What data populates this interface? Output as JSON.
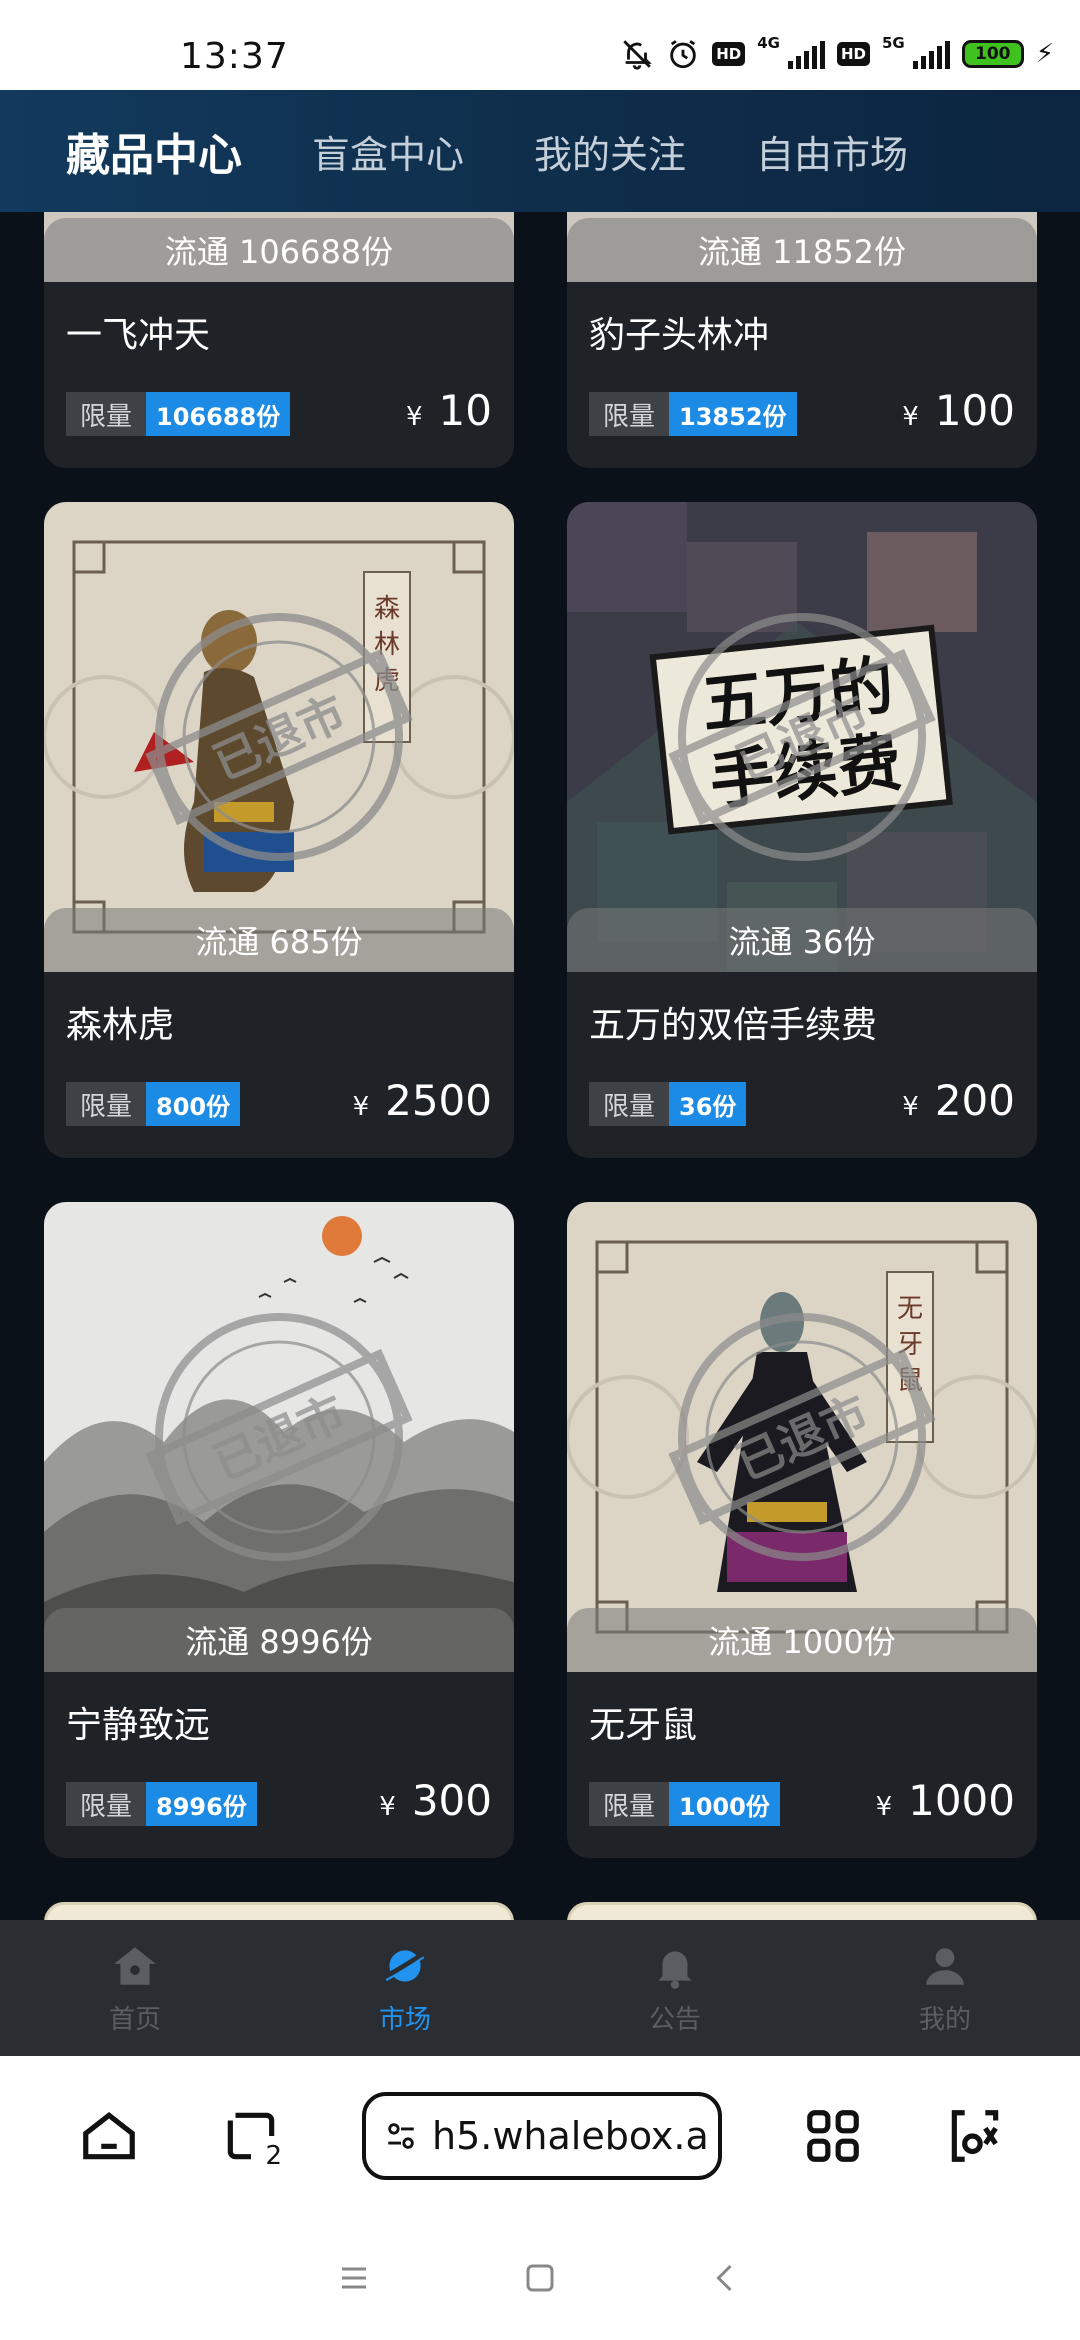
{
  "status_bar": {
    "time": "13:37",
    "net1": "4G",
    "net2": "5G",
    "hd": "HD",
    "battery": "100",
    "icons": [
      "mute-bell-icon",
      "alarm-icon",
      "hd-icon",
      "signal-icon",
      "battery-icon",
      "charging-icon"
    ]
  },
  "top_tabs": [
    {
      "label": "藏品中心",
      "active": true
    },
    {
      "label": "盲盒中心",
      "active": false
    },
    {
      "label": "我的关注",
      "active": false
    },
    {
      "label": "自由市场",
      "active": false
    }
  ],
  "cards": [
    {
      "circulation": "流通 106688份",
      "title": "一飞冲天",
      "limit_label": "限量",
      "limit_value": "106688份",
      "price_symbol": "¥",
      "price": "10"
    },
    {
      "circulation": "流通 11852份",
      "title": "豹子头林冲",
      "limit_label": "限量",
      "limit_value": "13852份",
      "price_symbol": "¥",
      "price": "100"
    },
    {
      "circulation": "流通 685份",
      "title": "森林虎",
      "limit_label": "限量",
      "limit_value": "800份",
      "price_symbol": "¥",
      "price": "2500",
      "art_text": "森林虎",
      "stamp": "已退市"
    },
    {
      "circulation": "流通 36份",
      "title": "五万的双倍手续费",
      "limit_label": "限量",
      "limit_value": "36份",
      "price_symbol": "¥",
      "price": "200",
      "art_text": "五万的\n手续费",
      "stamp": "已退市"
    },
    {
      "circulation": "流通 8996份",
      "title": "宁静致远",
      "limit_label": "限量",
      "limit_value": "8996份",
      "price_symbol": "¥",
      "price": "300",
      "stamp": "已退市"
    },
    {
      "circulation": "流通 1000份",
      "title": "无牙鼠",
      "limit_label": "限量",
      "limit_value": "1000份",
      "price_symbol": "¥",
      "price": "1000",
      "art_text": "无牙鼠",
      "stamp": "已退市"
    }
  ],
  "bottom_nav": [
    {
      "label": "首页",
      "icon": "home-icon",
      "active": false
    },
    {
      "label": "市场",
      "icon": "planet-icon",
      "active": true
    },
    {
      "label": "公告",
      "icon": "bell-icon",
      "active": false
    },
    {
      "label": "我的",
      "icon": "user-icon",
      "active": false
    }
  ],
  "browser": {
    "url": "h5.whalebox.a",
    "tab_count": "2"
  },
  "colors": {
    "accent_blue": "#1c8be6",
    "nav_active": "#2294f0",
    "card_bg": "#1f2227",
    "header_bg": "#0f2f4d"
  }
}
